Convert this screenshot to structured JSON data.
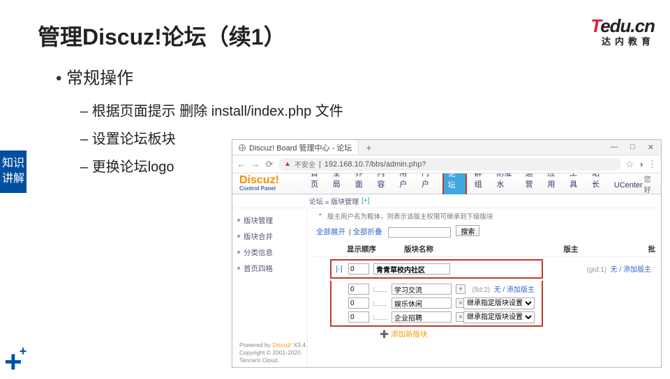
{
  "slide": {
    "title": "管理Discuz!论坛（续1）",
    "bullet": "常规操作",
    "subs": [
      "根据页面提示 删除 install/index.php 文件",
      "设置论坛板块",
      "更换论坛logo"
    ],
    "side_tab": "知识讲解",
    "logo_main_t": "T",
    "logo_main_rest": "edu.cn",
    "logo_sub": "达内教育"
  },
  "browser": {
    "tab_title": "Discuz! Board 管理中心 - 论坛",
    "insecure": "不安全",
    "url": "192.168.10.7/bbs/admin.php?",
    "win_min": "—",
    "win_max": "□",
    "win_close": "✕"
  },
  "panel": {
    "brand": "Discuz!",
    "brand_sub": "Control Panel",
    "hello": "您好",
    "nav": [
      "首页",
      "全局",
      "界面",
      "内容",
      "用户",
      "门户",
      "论坛",
      "群组",
      "防灌水",
      "运营",
      "应用",
      "工具",
      "站长",
      "UCenter"
    ],
    "crumb": "论坛 » 版块管理",
    "crumb_plus": "[+]",
    "sidebar": [
      "版块管理",
      "版块合并",
      "分类信息",
      "首页四格"
    ],
    "tip": "版主用户名为粗体，则表示该版主权限可继承到下级版块",
    "expand_all": "全部展开",
    "collapse_all": "全部折叠",
    "search_btn": "搜索",
    "head_order": "显示顺序",
    "head_name": "版块名称",
    "head_owner": "版主",
    "head_batch": "批",
    "collapse_sym": "[-]",
    "rows": [
      {
        "order": "0",
        "name": "青青草校内社区",
        "gid": "(gid:1)",
        "action": "无 / 添加版主",
        "top": true
      },
      {
        "order": "0",
        "name": "学习交流",
        "gid": "(fid:2)",
        "action": "无 / 添加版主",
        "plus": true
      },
      {
        "order": "0",
        "name": "娱乐休闲",
        "sel": "继承指定版块设置",
        "x": true
      },
      {
        "order": "0",
        "name": "企业招聘",
        "sel": "继承指定版块设置",
        "x": true
      }
    ],
    "add_new": "添加新版块",
    "footer_l1": "Powered by Discuz! X3.4",
    "footer_l2": "Copyright © 2001-2020",
    "footer_l3": "Tencent Cloud."
  }
}
